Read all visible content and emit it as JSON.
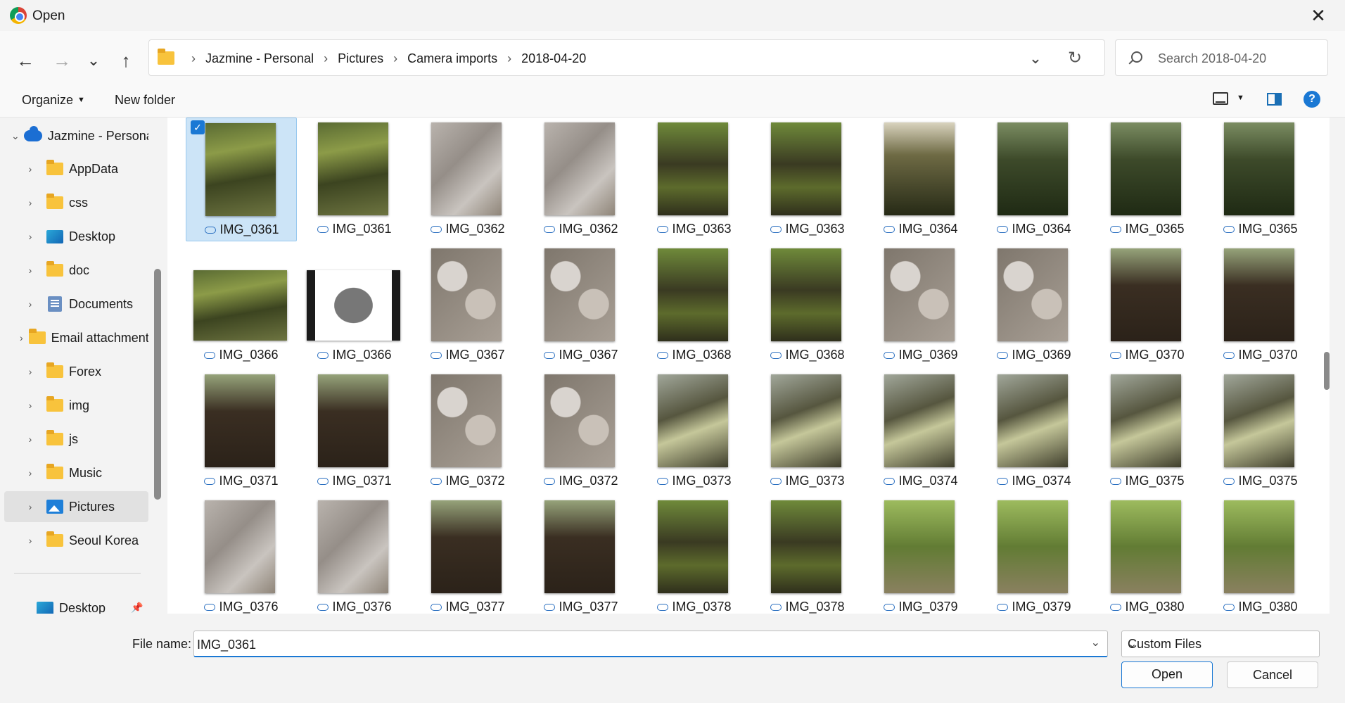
{
  "window": {
    "title": "Open",
    "close_glyph": "✕"
  },
  "nav": {
    "back_glyph": "←",
    "forward_glyph": "→",
    "recent_glyph": "⌄",
    "up_glyph": "↑",
    "breadcrumbs": [
      "Jazmine - Personal",
      "Pictures",
      "Camera imports",
      "2018-04-20"
    ],
    "separator": "›",
    "dropdown_glyph": "⌄",
    "refresh_glyph": "↻"
  },
  "search": {
    "placeholder": "Search 2018-04-20"
  },
  "command_bar": {
    "organize": "Organize",
    "new_folder": "New folder",
    "help": "?"
  },
  "sidebar": {
    "items": [
      {
        "label": "Jazmine - Personal",
        "icon": "cloud-icon",
        "expanded": true
      },
      {
        "label": "AppData",
        "icon": "folder-icon"
      },
      {
        "label": "css",
        "icon": "folder-icon"
      },
      {
        "label": "Desktop",
        "icon": "desktop-icon"
      },
      {
        "label": "doc",
        "icon": "folder-icon"
      },
      {
        "label": "Documents",
        "icon": "documents-icon"
      },
      {
        "label": "Email attachments",
        "icon": "folder-icon"
      },
      {
        "label": "Forex",
        "icon": "folder-icon"
      },
      {
        "label": "img",
        "icon": "folder-icon"
      },
      {
        "label": "js",
        "icon": "folder-icon"
      },
      {
        "label": "Music",
        "icon": "folder-icon"
      },
      {
        "label": "Pictures",
        "icon": "pictures-icon",
        "selected": true
      },
      {
        "label": "Seoul Korea",
        "icon": "folder-icon"
      }
    ],
    "quick_access": [
      {
        "label": "Desktop",
        "icon": "desktop-icon",
        "pinned": true
      }
    ]
  },
  "files": [
    {
      "name": "IMG_0361",
      "style": "green",
      "selected": true
    },
    {
      "name": "IMG_0361",
      "style": "green"
    },
    {
      "name": "IMG_0362",
      "style": "rock"
    },
    {
      "name": "IMG_0362",
      "style": "rock"
    },
    {
      "name": "IMG_0363",
      "style": "forest"
    },
    {
      "name": "IMG_0363",
      "style": "forest"
    },
    {
      "name": "IMG_0364",
      "style": "sunset"
    },
    {
      "name": "IMG_0364",
      "style": "dark"
    },
    {
      "name": "IMG_0365",
      "style": "dark"
    },
    {
      "name": "IMG_0365",
      "style": "dark"
    },
    {
      "name": "IMG_0366",
      "style": "green",
      "orientation": "landscape"
    },
    {
      "name": "IMG_0366",
      "style": "green",
      "orientation": "landscape",
      "video": true
    },
    {
      "name": "IMG_0367",
      "style": "stones"
    },
    {
      "name": "IMG_0367",
      "style": "stones"
    },
    {
      "name": "IMG_0368",
      "style": "forest"
    },
    {
      "name": "IMG_0368",
      "style": "forest"
    },
    {
      "name": "IMG_0369",
      "style": "stones"
    },
    {
      "name": "IMG_0369",
      "style": "stones"
    },
    {
      "name": "IMG_0370",
      "style": "pines"
    },
    {
      "name": "IMG_0370",
      "style": "pines"
    },
    {
      "name": "IMG_0371",
      "style": "pines"
    },
    {
      "name": "IMG_0371",
      "style": "pines"
    },
    {
      "name": "IMG_0372",
      "style": "stones"
    },
    {
      "name": "IMG_0372",
      "style": "stones"
    },
    {
      "name": "IMG_0373",
      "style": "leaf"
    },
    {
      "name": "IMG_0373",
      "style": "leaf"
    },
    {
      "name": "IMG_0374",
      "style": "leaf"
    },
    {
      "name": "IMG_0374",
      "style": "leaf"
    },
    {
      "name": "IMG_0375",
      "style": "leaf"
    },
    {
      "name": "IMG_0375",
      "style": "leaf"
    },
    {
      "name": "IMG_0376",
      "style": "rock"
    },
    {
      "name": "IMG_0376",
      "style": "rock"
    },
    {
      "name": "IMG_0377",
      "style": "pines"
    },
    {
      "name": "IMG_0377",
      "style": "pines"
    },
    {
      "name": "IMG_0378",
      "style": "forest"
    },
    {
      "name": "IMG_0378",
      "style": "forest"
    },
    {
      "name": "IMG_0379",
      "style": "bright"
    },
    {
      "name": "IMG_0379",
      "style": "bright"
    },
    {
      "name": "IMG_0380",
      "style": "bright"
    },
    {
      "name": "IMG_0380",
      "style": "bright"
    }
  ],
  "footer": {
    "file_name_label": "File name:",
    "file_name_value": "IMG_0361",
    "file_type": "Custom Files",
    "open": "Open",
    "cancel": "Cancel"
  }
}
